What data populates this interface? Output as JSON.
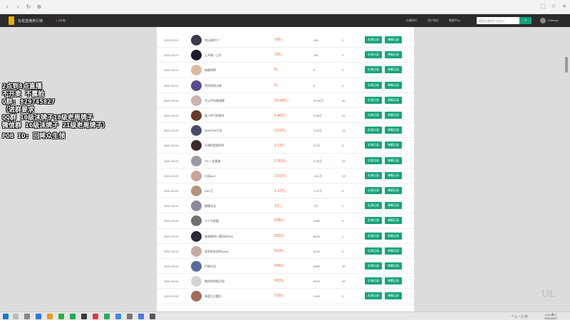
{
  "app": {
    "title": "在看直播排行榜",
    "location": "[本地]"
  },
  "nav": [
    "后端排行",
    "用户排行",
    "数据中心"
  ],
  "search": {
    "placeholder": "搜索主播用户名的ID"
  },
  "lang": "Chinese",
  "rows": [
    {
      "date": "2021-02-01",
      "name": "铭记谁时TT",
      "amt": "100",
      "unit": "元",
      "cnt": "100",
      "num": "0"
    },
    {
      "date": "2021-02-01",
      "name": "上升维一上升",
      "amt": "100",
      "unit": "元",
      "cnt": "100",
      "num": "0"
    },
    {
      "date": "2021-02-01",
      "name": "绿曲明明",
      "amt": "8",
      "unit": "元",
      "cnt": "8",
      "num": "0"
    },
    {
      "date": "2021-02-01",
      "name": "黑的四角沙神",
      "amt": "6",
      "unit": "元",
      "cnt": "6",
      "num": "0"
    },
    {
      "date": "2021-02-02",
      "name": "不过不怕我感情",
      "amt": "20.84万",
      "unit": "元",
      "cnt": "20.84万",
      "num": "30"
    },
    {
      "date": "2021-02-02",
      "name": "路人的气网格车",
      "amt": "5.48万",
      "unit": "元",
      "cnt": "5.48万",
      "num": "21"
    },
    {
      "date": "2021-02-02",
      "name": "MASTER小白",
      "amt": "3.53万",
      "unit": "元",
      "cnt": "3.53万",
      "num": "13"
    },
    {
      "date": "2021-02-02",
      "name": "不想的是那样怀",
      "amt": "3.2万",
      "unit": "元",
      "cnt": "3.2万",
      "num": "8"
    },
    {
      "date": "2021-02-02",
      "name": "TD一 定要爽",
      "amt": "2.35万",
      "unit": "元",
      "cnt": "2.35万",
      "num": "23"
    },
    {
      "date": "2021-02-02",
      "name": "口语mm~",
      "amt": "1.61万",
      "unit": "元",
      "cnt": "1.61万",
      "num": "13"
    },
    {
      "date": "2021-02-02",
      "name": "ZAC王",
      "amt": "1.37万",
      "unit": "元",
      "cnt": "1.37万",
      "num": "6"
    },
    {
      "date": "2021-02-02",
      "name": "猫猫宝宝",
      "amt": "1万",
      "unit": "元",
      "cnt": "1万",
      "num": "1"
    },
    {
      "date": "2021-02-02",
      "name": "十二月老猫",
      "amt": "9280",
      "unit": "元",
      "cnt": "9280",
      "num": "5"
    },
    {
      "date": "2021-02-02",
      "name": "服装维明人我伍的PDD",
      "amt": "8220",
      "unit": "元",
      "cnt": "8220",
      "num": "1"
    },
    {
      "date": "2021-02-02",
      "name": "金秋的金金的kumb",
      "amt": "8118",
      "unit": "元",
      "cnt": "8118",
      "num": "3"
    },
    {
      "date": "2021-02-02",
      "name": "严格乐风",
      "amt": "6960",
      "unit": "元",
      "cnt": "6960",
      "num": "10"
    },
    {
      "date": "2021-02-02",
      "name": "铁桥你的格子呀",
      "amt": "6915",
      "unit": "元",
      "cnt": "6915",
      "num": "26"
    },
    {
      "date": "2021-02-02",
      "name": "海蓝九大魔王~",
      "amt": "2100",
      "unit": "元",
      "cnt": "2100",
      "num": "0"
    }
  ],
  "buttons": {
    "b1": "礼物记录",
    "b2": "弹幕记录"
  },
  "avatarColors": [
    "#3a3a4a",
    "#1c1c2c",
    "#d9b9a0",
    "#5b4a8a",
    "#c9b4b4",
    "#6a3a2a",
    "#4a4a6a",
    "#3a2a2a",
    "#9a9aa4",
    "#caa498",
    "#b49482",
    "#8a8aa0",
    "#707070",
    "#2a2a3a",
    "#c6aaa0",
    "#5a6a9a",
    "#d4d4d8",
    "#a06a5a"
  ],
  "overlay": {
    "lines": [
      "2点到8点直播",
      "不开麦 不露脸",
      "Q群: 829745827",
      "（进群要求",
      "QQ群 10级沫牌子18级老周牌子",
      "微信群 16级沫牌子 21级老周牌子）"
    ],
    "pob": "POB ID: 回眸众生领"
  },
  "taskbar": {
    "time": "2:11 周二",
    "date": "2021/2/2?"
  },
  "watermark": "UL"
}
